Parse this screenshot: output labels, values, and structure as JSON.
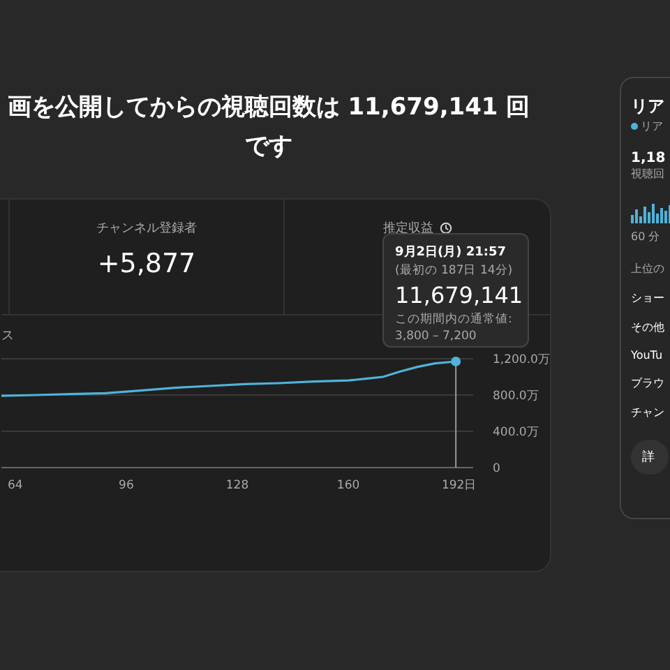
{
  "heading": {
    "line_1": "画を公開してからの視聴回数は 11,679,141 回",
    "line_2": "です"
  },
  "stats": [
    {
      "label": "チャンネル登録者",
      "value": "+5,877"
    },
    {
      "label": "推定収益"
    }
  ],
  "tooltip": {
    "date": "9月2日(月) 21:57",
    "period": "(最初の 187日 14分)",
    "value": "11,679,141",
    "range_label": "この期間内の通常値:",
    "range": "3,800 – 7,200"
  },
  "chart_label": "ス",
  "chart_data": {
    "type": "line",
    "x": [
      60,
      70,
      80,
      90,
      100,
      110,
      120,
      130,
      140,
      150,
      160,
      165,
      170,
      175,
      180,
      185,
      191
    ],
    "series": [
      {
        "color": "#4fb3d9",
        "values": [
          790,
          800,
          810,
          820,
          850,
          880,
          900,
          920,
          930,
          950,
          960,
          980,
          1000,
          1060,
          1110,
          1150,
          1170
        ]
      }
    ],
    "xlim": [
      60,
      196
    ],
    "ylim": [
      0,
      1200
    ],
    "xticks": [
      64,
      96,
      128,
      160,
      {
        "value": 192,
        "label": "192日"
      }
    ],
    "yticks": [
      {
        "value": 0,
        "label": "0"
      },
      {
        "value": 400,
        "label": "400.0万"
      },
      {
        "value": 800,
        "label": "800.0万"
      },
      {
        "value": 1200,
        "label": "1,200.0万"
      }
    ],
    "ref_lines": [
      {
        "axis": "x",
        "value": 191
      }
    ]
  },
  "realtime": {
    "title": "リア",
    "live_label": "リア",
    "count": "1,18",
    "count_label": "視聴回",
    "time_label": "60 分",
    "top_label": "上位の",
    "items": [
      "ショー",
      "その他",
      "YouTu",
      "ブラウ",
      "チャン"
    ],
    "button": "詳"
  }
}
